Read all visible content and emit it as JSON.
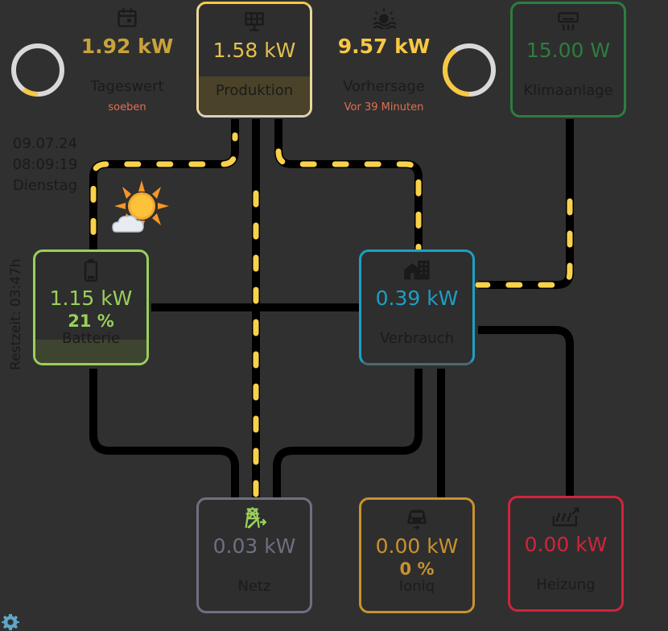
{
  "colors": {
    "background": "#303030",
    "solar": "#f7c843",
    "battery": "#99d05a",
    "grid": "#6d7080",
    "home": "#1ca0c2",
    "ac": "#2e7d3e",
    "car": "#c9922f",
    "heating": "#d0243a",
    "flow_dash": "#f9d14a",
    "line": "#000000"
  },
  "datetime": {
    "date": "09.07.24",
    "time": "08:09:19",
    "weekday": "Dienstag"
  },
  "remaining": "Restzeit: 03:47h",
  "daily": {
    "value": "1.92 kW",
    "label": "Tageswert",
    "sub": "soeben",
    "icon": "calendar-icon",
    "ring_fraction": 0.1
  },
  "forecast": {
    "value": "9.57 kW",
    "label": "Vorhersage",
    "sub": "Vor 39 Minuten",
    "icon": "sunrise-icon",
    "ring_fraction": 0.4
  },
  "production": {
    "value": "1.58 kW",
    "label": "Produktion",
    "icon": "solar-panel-icon",
    "fill_fraction": 0.35
  },
  "climate": {
    "value": "15.00 W",
    "label": "Klimaanlage",
    "icon": "air-conditioner-icon"
  },
  "battery": {
    "value": "1.15 kW",
    "percent": "21 %",
    "label": "Batterie",
    "icon": "battery-icon",
    "fill_fraction": 0.21
  },
  "consumption": {
    "value": "0.39 kW",
    "label": "Verbrauch",
    "icon": "home-icon"
  },
  "grid": {
    "value": "0.03 kW",
    "label": "Netz",
    "icon": "transmission-tower-icon"
  },
  "ioniq": {
    "value": "0.00 kW",
    "percent": "0 %",
    "label": "Ioniq",
    "icon": "car-icon"
  },
  "heating": {
    "value": "0.00 kW",
    "label": "Heizung",
    "icon": "heat-pump-icon"
  },
  "weather_icon": "partly-sunny-icon",
  "settings_icon": "gear-icon"
}
